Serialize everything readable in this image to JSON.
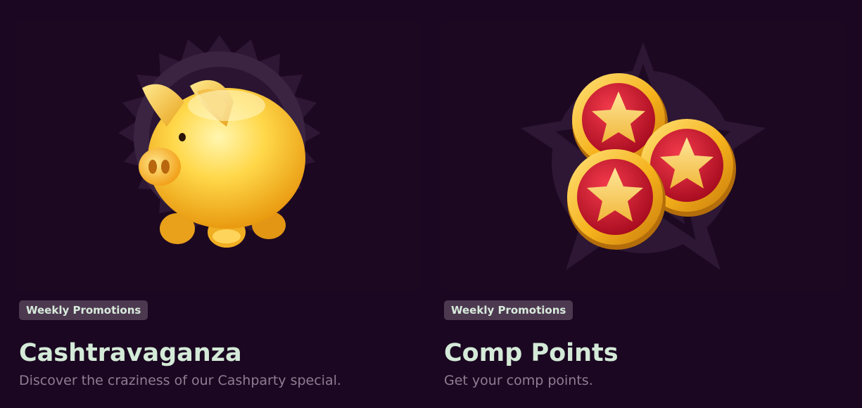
{
  "promotions": [
    {
      "badge": "Weekly Promotions",
      "title": "Cashtravaganza",
      "description": "Discover the craziness of our Cashparty special.",
      "icon": "piggy-bank-icon"
    },
    {
      "badge": "Weekly Promotions",
      "title": "Comp Points",
      "description": "Get your comp points.",
      "icon": "star-coins-icon"
    }
  ],
  "colors": {
    "background": "#1b0721",
    "card_background": "#1d0822",
    "badge_background": "#4c3950",
    "title_text": "#d4ead8",
    "description_text": "#8f7d93",
    "gold": "#f5c542",
    "coin_red": "#c8132a"
  }
}
